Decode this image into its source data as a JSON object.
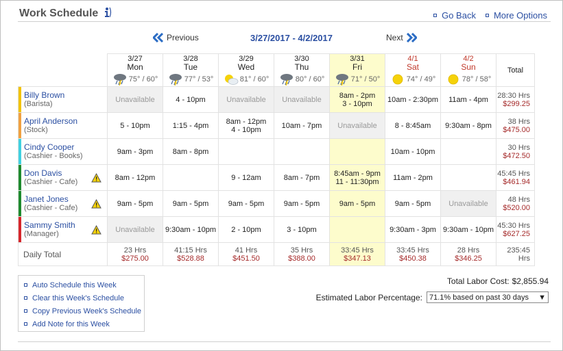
{
  "header": {
    "title": "Work Schedule",
    "go_back": "Go Back",
    "more_options": "More Options"
  },
  "nav": {
    "previous": "Previous",
    "next": "Next",
    "range": "3/27/2017 - 4/2/2017"
  },
  "days": [
    {
      "date": "3/27",
      "name": "Mon",
      "weather": "storm",
      "temp": "75° / 60°",
      "weekend": false,
      "today": false
    },
    {
      "date": "3/28",
      "name": "Tue",
      "weather": "storm",
      "temp": "77° / 53°",
      "weekend": false,
      "today": false
    },
    {
      "date": "3/29",
      "name": "Wed",
      "weather": "partly-sunny",
      "temp": "81° / 60°",
      "weekend": false,
      "today": false
    },
    {
      "date": "3/30",
      "name": "Thu",
      "weather": "storm",
      "temp": "80° / 60°",
      "weekend": false,
      "today": false
    },
    {
      "date": "3/31",
      "name": "Fri",
      "weather": "storm",
      "temp": "71° / 50°",
      "weekend": false,
      "today": true
    },
    {
      "date": "4/1",
      "name": "Sat",
      "weather": "sunny",
      "temp": "74° / 49°",
      "weekend": true,
      "today": false
    },
    {
      "date": "4/2",
      "name": "Sun",
      "weather": "sunny",
      "temp": "78° / 58°",
      "weekend": true,
      "today": false
    }
  ],
  "total_header": "Total",
  "employees": [
    {
      "name": "Billy Brown",
      "role": "(Barista)",
      "color": "#f2c300",
      "warning": false,
      "shifts": [
        [
          "Unavailable"
        ],
        [
          "4 - 10pm"
        ],
        [
          "Unavailable"
        ],
        [
          "Unavailable"
        ],
        [
          "8am - 2pm",
          "3 - 10pm"
        ],
        [
          "10am - 2:30pm"
        ],
        [
          "11am - 4pm"
        ]
      ],
      "unavailable": [
        true,
        false,
        true,
        true,
        false,
        false,
        false
      ],
      "hours": "28:30 Hrs",
      "cost": "$299.25"
    },
    {
      "name": "April Anderson",
      "role": "(Stock)",
      "color": "#f0a040",
      "warning": false,
      "shifts": [
        [
          "5 - 10pm"
        ],
        [
          "1:15 - 4pm"
        ],
        [
          "8am - 12pm",
          "4 - 10pm"
        ],
        [
          "10am - 7pm"
        ],
        [
          "Unavailable"
        ],
        [
          "8 - 8:45am"
        ],
        [
          "9:30am - 8pm"
        ]
      ],
      "unavailable": [
        false,
        false,
        false,
        false,
        true,
        false,
        false
      ],
      "hours": "38 Hrs",
      "cost": "$475.00"
    },
    {
      "name": "Cindy Cooper",
      "role": "(Cashier - Books)",
      "color": "#3fd1e0",
      "warning": false,
      "shifts": [
        [
          "9am - 3pm"
        ],
        [
          "8am - 8pm"
        ],
        [],
        [],
        [],
        [
          "10am - 10pm"
        ],
        []
      ],
      "unavailable": [
        false,
        false,
        false,
        false,
        false,
        false,
        false
      ],
      "hours": "30 Hrs",
      "cost": "$472.50"
    },
    {
      "name": "Don Davis",
      "role": "(Cashier - Cafe)",
      "color": "#1e8a2e",
      "warning": true,
      "shifts": [
        [
          "8am - 12pm"
        ],
        [],
        [
          "9 - 12am"
        ],
        [
          "8am - 7pm"
        ],
        [
          "8:45am - 9pm",
          "11 - 11:30pm"
        ],
        [
          "11am - 2pm"
        ],
        []
      ],
      "unavailable": [
        false,
        false,
        false,
        false,
        false,
        false,
        false
      ],
      "hours": "45:45 Hrs",
      "cost": "$461.94"
    },
    {
      "name": "Janet Jones",
      "role": "(Cashier - Cafe)",
      "color": "#1e8a2e",
      "warning": true,
      "shifts": [
        [
          "9am - 5pm"
        ],
        [
          "9am - 5pm"
        ],
        [
          "9am - 5pm"
        ],
        [
          "9am - 5pm"
        ],
        [
          "9am - 5pm"
        ],
        [
          "9am - 5pm"
        ],
        [
          "Unavailable"
        ]
      ],
      "unavailable": [
        false,
        false,
        false,
        false,
        false,
        false,
        true
      ],
      "hours": "48 Hrs",
      "cost": "$520.00"
    },
    {
      "name": "Sammy Smith",
      "role": "(Manager)",
      "color": "#d6262b",
      "warning": true,
      "shifts": [
        [
          "Unavailable"
        ],
        [
          "9:30am - 10pm"
        ],
        [
          "2 - 10pm"
        ],
        [
          "3 - 10pm"
        ],
        [],
        [
          "9:30am - 3pm"
        ],
        [
          "9:30am - 10pm"
        ]
      ],
      "unavailable": [
        true,
        false,
        false,
        false,
        false,
        false,
        false
      ],
      "hours": "45:30 Hrs",
      "cost": "$627.25"
    }
  ],
  "daily_total": {
    "label": "Daily Total",
    "days": [
      {
        "hours": "23 Hrs",
        "cost": "$275.00"
      },
      {
        "hours": "41:15 Hrs",
        "cost": "$528.88"
      },
      {
        "hours": "41 Hrs",
        "cost": "$451.50"
      },
      {
        "hours": "35 Hrs",
        "cost": "$388.00"
      },
      {
        "hours": "33:45 Hrs",
        "cost": "$347.13"
      },
      {
        "hours": "33:45 Hrs",
        "cost": "$450.38"
      },
      {
        "hours": "28 Hrs",
        "cost": "$346.25"
      }
    ],
    "total": "235:45 Hrs"
  },
  "actions": [
    "Auto Schedule this Week",
    "Clear this Week's Schedule",
    "Copy Previous Week's Schedule",
    "Add Note for this Week"
  ],
  "labor": {
    "total_label": "Total Labor Cost:",
    "total_value": "$2,855.94",
    "estimate_label": "Estimated Labor Percentage:",
    "estimate_value": "71.1% based on past 30 days"
  },
  "colors": {
    "link": "#2b4fa2",
    "money": "#a52a2a",
    "today": "#fdfccc",
    "unavailable": "#f0f0f0"
  }
}
